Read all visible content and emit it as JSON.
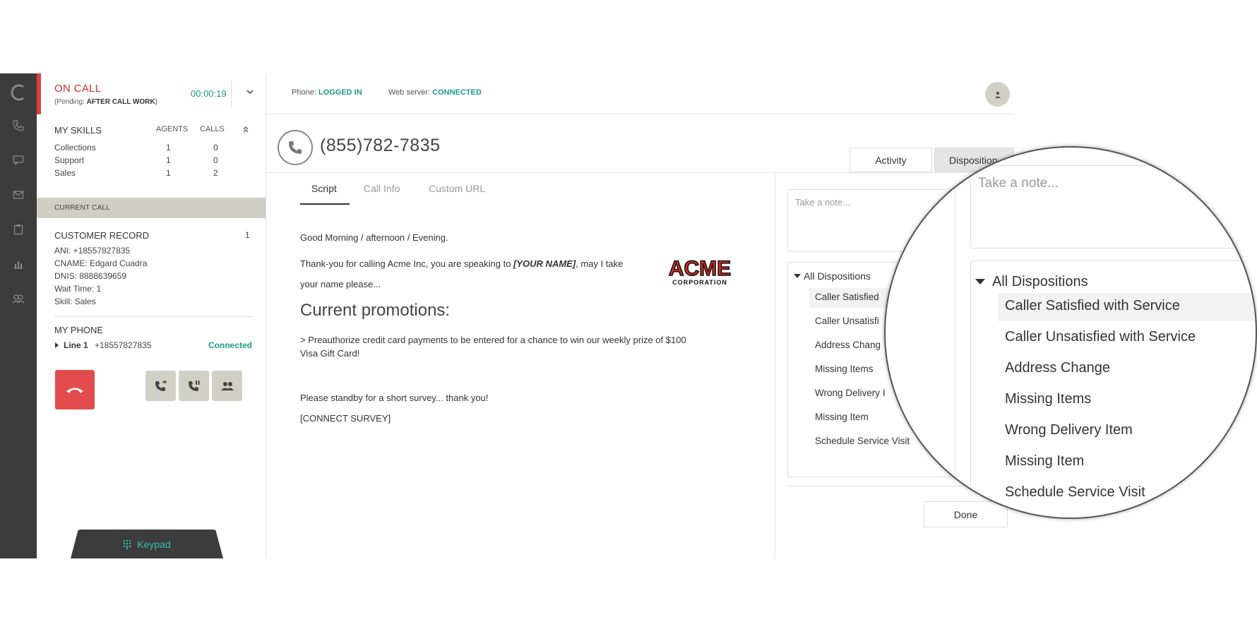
{
  "header": {
    "status": "ON CALL",
    "pending_prefix": "(Pending: ",
    "pending_value": "AFTER CALL WORK",
    "pending_suffix": ")",
    "timer": "00:00:19"
  },
  "skills": {
    "title": "MY SKILLS",
    "col_agents": "AGENTS",
    "col_calls": "CALLS",
    "rows": [
      {
        "name": "Collections",
        "agents": "1",
        "calls": "0"
      },
      {
        "name": "Support",
        "agents": "1",
        "calls": "0"
      },
      {
        "name": "Sales",
        "agents": "1",
        "calls": "2"
      }
    ]
  },
  "current_call": {
    "bar_label": "CURRENT CALL",
    "record_title": "CUSTOMER RECORD",
    "record_count": "1",
    "fields": [
      "ANI: +18557827835",
      "CNAME: Edgard Cuadra",
      "DNIS: 8888639659",
      "Wait Time: 1",
      "Skill: Sales"
    ]
  },
  "my_phone": {
    "title": "MY PHONE",
    "line_label": "Line 1",
    "line_number": "+18557827835",
    "line_status": "Connected"
  },
  "keypad_label": "Keypad",
  "topbar": {
    "phone_label": "Phone: ",
    "phone_status": "LOGGED IN",
    "web_label": "Web server: ",
    "web_status": "CONNECTED"
  },
  "call": {
    "number": "(855)782-7835"
  },
  "tabs": {
    "activity": "Activity",
    "disposition": "Disposition"
  },
  "subtabs": [
    "Script",
    "Call Info",
    "Custom URL"
  ],
  "script": {
    "greeting": "Good Morning / afternoon / Evening.",
    "thanks_pre": "Thank-you for calling Acme Inc, you are speaking to ",
    "thanks_name": "[YOUR NAME]",
    "thanks_post": ", may I take",
    "thanks_line2": "your name please...",
    "promo_title": "Current promotions:",
    "promo_line1": " > Preauthorize credit card payments to be entered for a chance to win our weekly prize of $100",
    "promo_line2": "Visa Gift Card!",
    "survey": "Please standby for a short survey... thank you!",
    "connect": "[CONNECT SURVEY]",
    "logo_main": "ACME",
    "logo_sub": "CORPORATION"
  },
  "disposition": {
    "note_placeholder": "Take a note...",
    "all_label": "All Dispositions",
    "items_truncated": [
      "Caller Satisfied",
      "Caller Unsatisfi",
      "Address Chang",
      "Missing Items",
      "Wrong Delivery I",
      "Missing Item",
      "Schedule Service Visit"
    ],
    "items": [
      "Caller Satisfied with Service",
      "Caller Unsatisfied with Service",
      "Address Change",
      "Missing Items",
      "Wrong Delivery Item",
      "Missing Item",
      "Schedule Service Visit"
    ],
    "done": "Done"
  },
  "colors": {
    "accent": "#1b9c85",
    "alert": "#e34c4c",
    "rail": "#3c3c3c"
  }
}
